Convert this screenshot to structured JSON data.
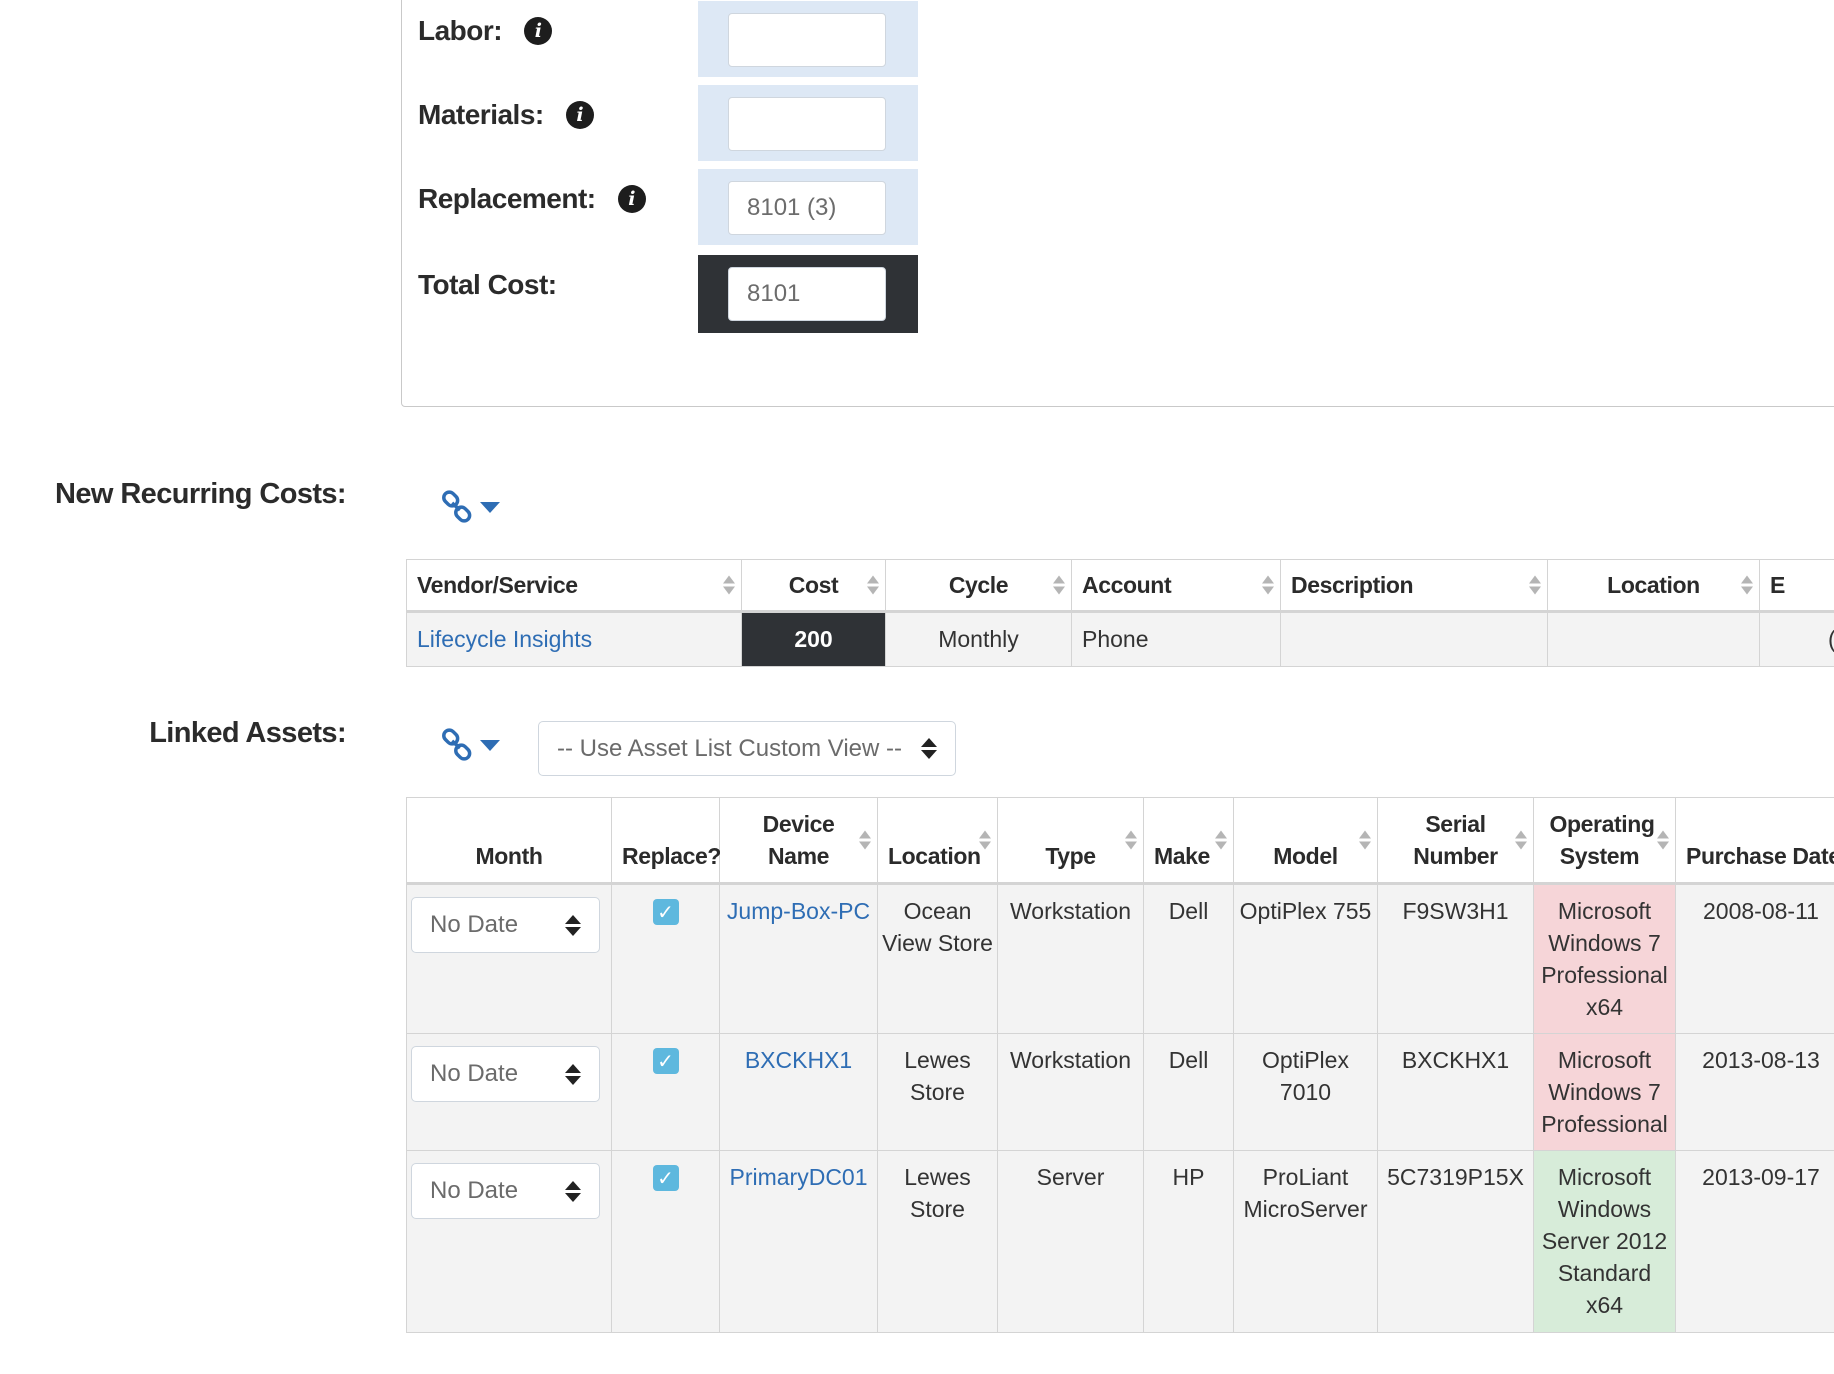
{
  "cost_fields": [
    {
      "label": "Labor:",
      "value": "",
      "info": true,
      "dark": false
    },
    {
      "label": "Materials:",
      "value": "",
      "info": true,
      "dark": false
    },
    {
      "label": "Replacement:",
      "value": "8101 (3)",
      "info": true,
      "dark": false
    },
    {
      "label": "Total Cost:",
      "value": "8101",
      "info": false,
      "dark": true
    }
  ],
  "recurring": {
    "label": "New Recurring Costs:",
    "columns": [
      "Vendor/Service",
      "Cost",
      "Cycle",
      "Account",
      "Description",
      "Location",
      "E"
    ],
    "rows": [
      {
        "vendor": "Lifecycle Insights",
        "cost": "200",
        "cycle": "Monthly",
        "account": "Phone",
        "description": "",
        "location": "",
        "extra": "("
      }
    ]
  },
  "linked": {
    "label": "Linked Assets:",
    "view_select": "-- Use Asset List Custom View --",
    "columns": [
      "Month",
      "Replace?",
      "Device Name",
      "Location",
      "Type",
      "Make",
      "Model",
      "Serial Number",
      "Operating System",
      "Purchase Date"
    ],
    "rows": [
      {
        "month": "No Date",
        "replace": true,
        "device": "Jump-Box-PC",
        "location": "Ocean View Store",
        "type": "Workstation",
        "make": "Dell",
        "model": "OptiPlex 755",
        "serial": "F9SW3H1",
        "os": "Microsoft Windows 7 Professional x64",
        "os_status": "red",
        "purchase": "2008-08-11"
      },
      {
        "month": "No Date",
        "replace": true,
        "device": "BXCKHX1",
        "location": "Lewes Store",
        "type": "Workstation",
        "make": "Dell",
        "model": "OptiPlex 7010",
        "serial": "BXCKHX1",
        "os": "Microsoft Windows 7 Professional",
        "os_status": "red",
        "purchase": "2013-08-13"
      },
      {
        "month": "No Date",
        "replace": true,
        "device": "PrimaryDC01",
        "location": "Lewes Store",
        "type": "Server",
        "make": "HP",
        "model": "ProLiant MicroServer",
        "serial": "5C7319P15X",
        "os": "Microsoft Windows Server 2012 Standard x64",
        "os_status": "green",
        "purchase": "2013-09-17"
      }
    ]
  },
  "colors": {
    "accent": "#2e6db4",
    "dark_cell": "#2f3236",
    "os_red": "#f6d5d8",
    "os_green": "#d7ecd9",
    "cost_cell": "#dde8f5",
    "checkbox": "#5eb8de"
  }
}
